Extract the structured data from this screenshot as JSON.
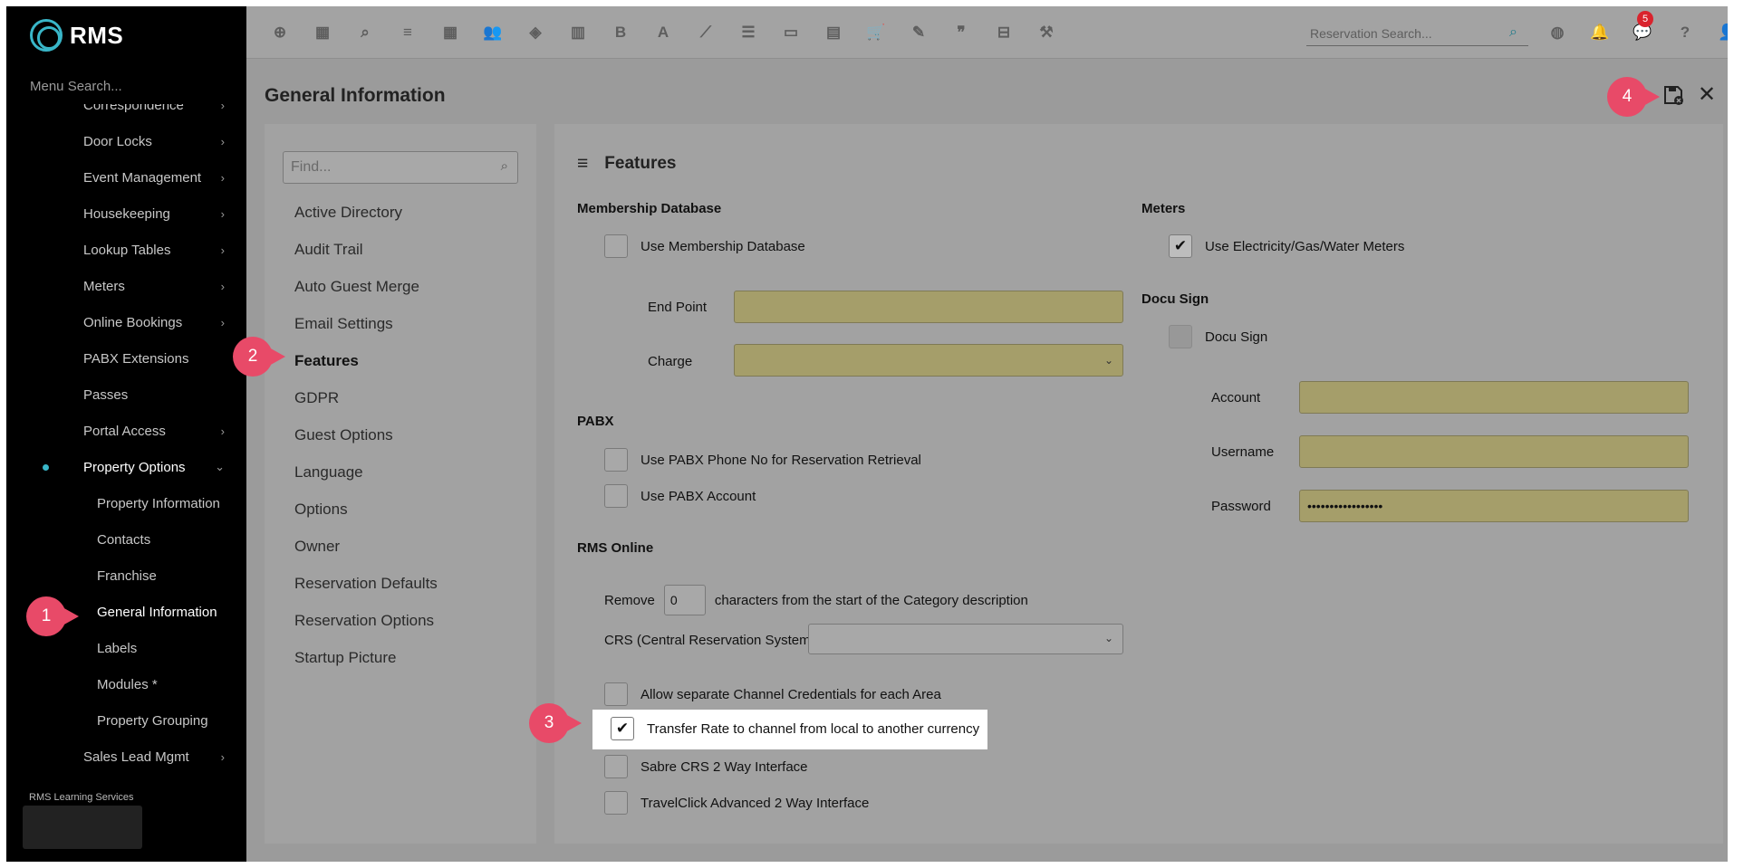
{
  "app": {
    "logo_text": "RMS",
    "accent": "#39b6c8",
    "callout_color": "#e84a68"
  },
  "sidebar": {
    "search_placeholder": "Menu Search...",
    "items": [
      {
        "label": "Correspondence",
        "chevron": "›"
      },
      {
        "label": "Door Locks",
        "chevron": "›"
      },
      {
        "label": "Event Management",
        "chevron": "›"
      },
      {
        "label": "Housekeeping",
        "chevron": "›"
      },
      {
        "label": "Lookup Tables",
        "chevron": "›"
      },
      {
        "label": "Meters",
        "chevron": "›"
      },
      {
        "label": "Online Bookings",
        "chevron": "›"
      },
      {
        "label": "PABX Extensions",
        "chevron": ""
      },
      {
        "label": "Passes",
        "chevron": ""
      },
      {
        "label": "Portal Access",
        "chevron": "›"
      },
      {
        "label": "Property Options",
        "chevron": "⌄"
      },
      {
        "label": "Property Information",
        "chevron": ""
      },
      {
        "label": "Contacts",
        "chevron": ""
      },
      {
        "label": "Franchise",
        "chevron": ""
      },
      {
        "label": "General Information",
        "chevron": ""
      },
      {
        "label": "Labels",
        "chevron": ""
      },
      {
        "label": "Modules *",
        "chevron": ""
      },
      {
        "label": "Property Grouping",
        "chevron": ""
      },
      {
        "label": "Sales Lead Mgmt",
        "chevron": "›"
      }
    ],
    "footer": "RMS Learning Services"
  },
  "topbar": {
    "icons": [
      "add-icon",
      "calendar-icon",
      "search-icon",
      "sliders-icon",
      "grid-icon",
      "guests-icon",
      "map-pin-icon",
      "map-icon",
      "bold-icon",
      "text-icon",
      "chart-icon",
      "checklist-icon",
      "card-icon",
      "report-icon",
      "cart-icon",
      "voucher-icon",
      "quote-icon",
      "bed-icon",
      "hammer-icon"
    ],
    "icon_glyphs": [
      "⊕",
      "▦",
      "⌕",
      "≡",
      "▦",
      "👥",
      "◈",
      "▥",
      "B",
      "A",
      "⟋",
      "☰",
      "▭",
      "▤",
      "🛒",
      "✎",
      "❞",
      "⊟",
      "⚒"
    ],
    "reservation_search_placeholder": "Reservation Search...",
    "notification_count": "5"
  },
  "page": {
    "title": "General Information"
  },
  "nav": {
    "find_placeholder": "Find...",
    "items": [
      "Active Directory",
      "Audit Trail",
      "Auto Guest Merge",
      "Email Settings",
      "Features",
      "GDPR",
      "Guest Options",
      "Language",
      "Options",
      "Owner",
      "Reservation Defaults",
      "Reservation Options",
      "Startup Picture"
    ]
  },
  "features": {
    "title": "Features",
    "membership": {
      "heading": "Membership Database",
      "use_label": "Use Membership Database",
      "use_checked": false,
      "end_point_label": "End Point",
      "end_point_value": "",
      "charge_label": "Charge",
      "charge_value": ""
    },
    "pabx": {
      "heading": "PABX",
      "phone_label": "Use PABX Phone No for Reservation Retrieval",
      "account_label": "Use PABX Account"
    },
    "rms_online": {
      "heading": "RMS Online",
      "remove_prefix": "Remove",
      "remove_value": "0",
      "remove_suffix": "characters from the start of the Category description",
      "crs_label": "CRS (Central Reservation System)",
      "crs_value": "",
      "allow_separate_label": "Allow separate Channel Credentials for each Area",
      "transfer_rate_label": "Transfer Rate to channel from local to another currency",
      "transfer_rate_checked": true,
      "sabre_label": "Sabre CRS 2 Way Interface",
      "travelclick_label": "TravelClick Advanced 2 Way Interface"
    },
    "meters": {
      "heading": "Meters",
      "use_label": "Use Electricity/Gas/Water Meters",
      "use_checked": true
    },
    "docusign": {
      "heading": "Docu Sign",
      "use_label": "Docu Sign",
      "account_label": "Account",
      "account_value": "",
      "username_label": "Username",
      "username_value": "",
      "password_label": "Password",
      "password_value": "•••••••••••••••••"
    }
  },
  "callouts": [
    "1",
    "2",
    "3",
    "4"
  ]
}
